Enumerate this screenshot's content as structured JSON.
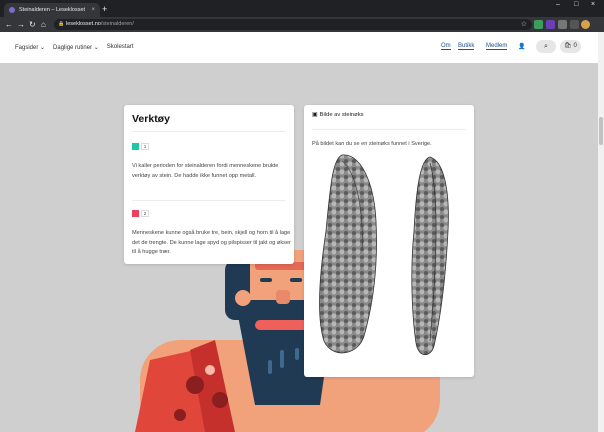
{
  "browser": {
    "tab_title": "Steinalderen – Leseklosset",
    "tab_close": "×",
    "new_tab": "+",
    "url_domain": "leseklosset.no",
    "url_path": "/steinalderen/",
    "minimize": "–",
    "maximize": "□",
    "close": "×"
  },
  "site_nav": {
    "left_items": [
      "Fagsider ⌄",
      "Daglige rutiner ⌄",
      "Skolestart"
    ],
    "right_items": [
      "Om",
      "Butikk",
      "Medlem"
    ],
    "bag_count": "0"
  },
  "card_tools": {
    "title": "Verktøy",
    "items": [
      {
        "number": "1",
        "color": "#1fc7a6",
        "text": "Vi kaller perioden for steinalderen fordi menneskene brukte verktøy av stein. De hadde ikke funnet opp metall."
      },
      {
        "number": "2",
        "color": "#ef4061",
        "text": "Menneskene kunne også bruke tre, bein, skjell og horn til å lage det de trengte. De kunne lage spyd og pilspisser til jakt og økser til å hugge trær."
      }
    ]
  },
  "card_image": {
    "title": "Bilde av steinøks",
    "caption": "På bildet kan du se en steinøks funnet i Sverige."
  },
  "colors": {
    "accent_teal": "#1fc7a6",
    "accent_red": "#ef4061",
    "link_blue": "#1e4f8a",
    "background": "#cfcfcf"
  }
}
